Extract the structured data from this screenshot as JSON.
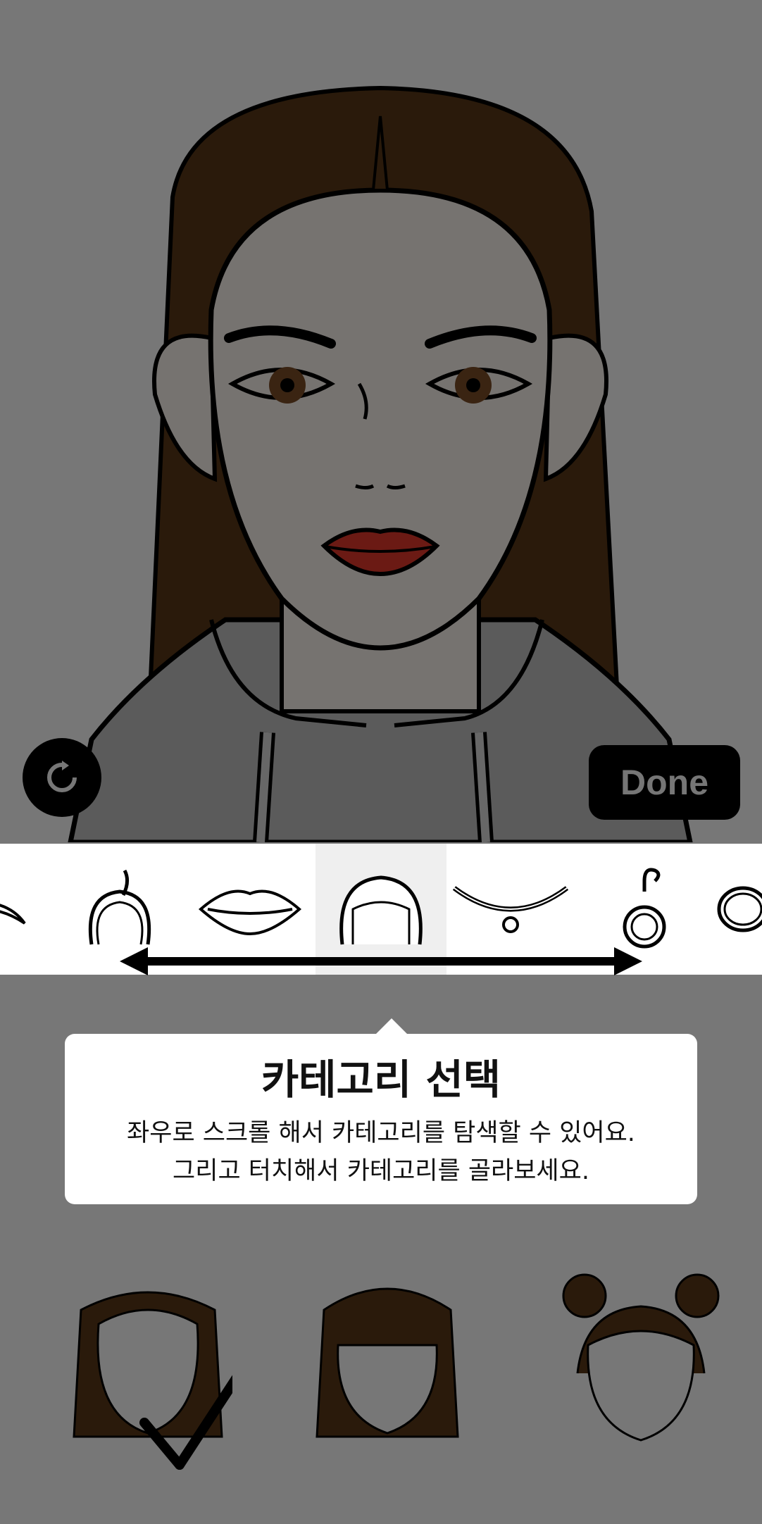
{
  "app": {
    "reset_icon": "refresh-icon",
    "done_label": "Done"
  },
  "categories": [
    {
      "name": "eyebrow",
      "icon": "eyebrow-icon",
      "selected": false
    },
    {
      "name": "headband",
      "icon": "headband-icon",
      "selected": false
    },
    {
      "name": "lips",
      "icon": "lips-icon",
      "selected": false
    },
    {
      "name": "hair",
      "icon": "hair-icon",
      "selected": true
    },
    {
      "name": "necklace",
      "icon": "necklace-icon",
      "selected": false
    },
    {
      "name": "earring",
      "icon": "earring-icon",
      "selected": false
    },
    {
      "name": "ring",
      "icon": "ring-icon",
      "selected": false
    }
  ],
  "tooltip": {
    "title": "카테고리 선택",
    "line1": "좌우로 스크롤 해서 카테고리를 탐색할 수 있어요.",
    "line2": "그리고 터치해서 카테고리를 골라보세요."
  },
  "hair_options": [
    {
      "name": "long-straight-hair",
      "selected": true
    },
    {
      "name": "bangs-hair",
      "selected": false
    },
    {
      "name": "space-buns-hair",
      "selected": false
    }
  ],
  "colors": {
    "overlay_gray": "#777777",
    "hair_brown": "#2a1a0b",
    "lip_red": "#6b1a14",
    "skin": "#767370"
  }
}
